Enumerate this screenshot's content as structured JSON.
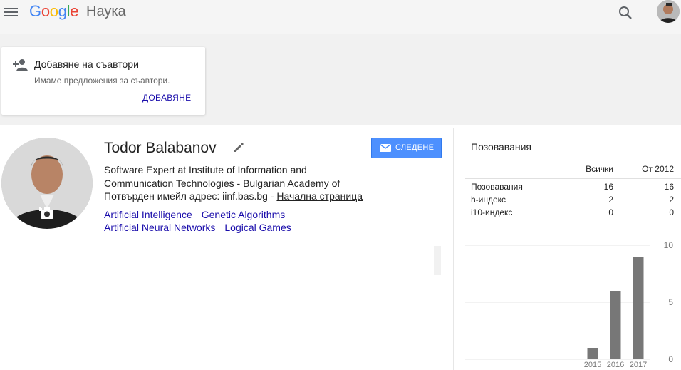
{
  "header": {
    "logo_letters": [
      "G",
      "o",
      "o",
      "g",
      "l",
      "e"
    ],
    "product": "Наука",
    "menu_icon": "hamburger-menu-icon",
    "search_icon": "search-icon"
  },
  "coauthors": {
    "title": "Добавяне на съавтори",
    "subtitle": "Имаме предложения за съавтори.",
    "action": "ДОБАВЯНЕ"
  },
  "profile": {
    "name": "Todor Balabanov",
    "follow_label": "СЛЕДЕНЕ",
    "affiliation": "Software Expert at Institute of Information and Communication Technologies - Bulgarian Academy of",
    "email_text": "Потвърден имейл адрес: iinf.bas.bg - ",
    "homepage_label": "Начална страница",
    "interests": [
      "Artificial Intelligence",
      "Genetic Algorithms",
      "Artificial Neural Networks",
      "Logical Games"
    ]
  },
  "citations": {
    "title": "Позовавания",
    "columns": [
      "",
      "Всички",
      "От 2012"
    ],
    "rows": [
      {
        "label": "Позовавания",
        "all": "16",
        "since": "16"
      },
      {
        "label": "h-индекс",
        "all": "2",
        "since": "2"
      },
      {
        "label": "i10-индекс",
        "all": "0",
        "since": "0"
      }
    ]
  },
  "chart_data": {
    "type": "bar",
    "categories": [
      "2015",
      "2016",
      "2017"
    ],
    "values": [
      1,
      6,
      9
    ],
    "ylim": [
      0,
      10
    ],
    "yticks": [
      "0",
      "5",
      "10"
    ],
    "bar_color": "#777777",
    "grid": true
  },
  "colors": {
    "link": "#1a0dab",
    "follow_button": "#4d90fe",
    "header_bg": "#f5f5f5"
  }
}
